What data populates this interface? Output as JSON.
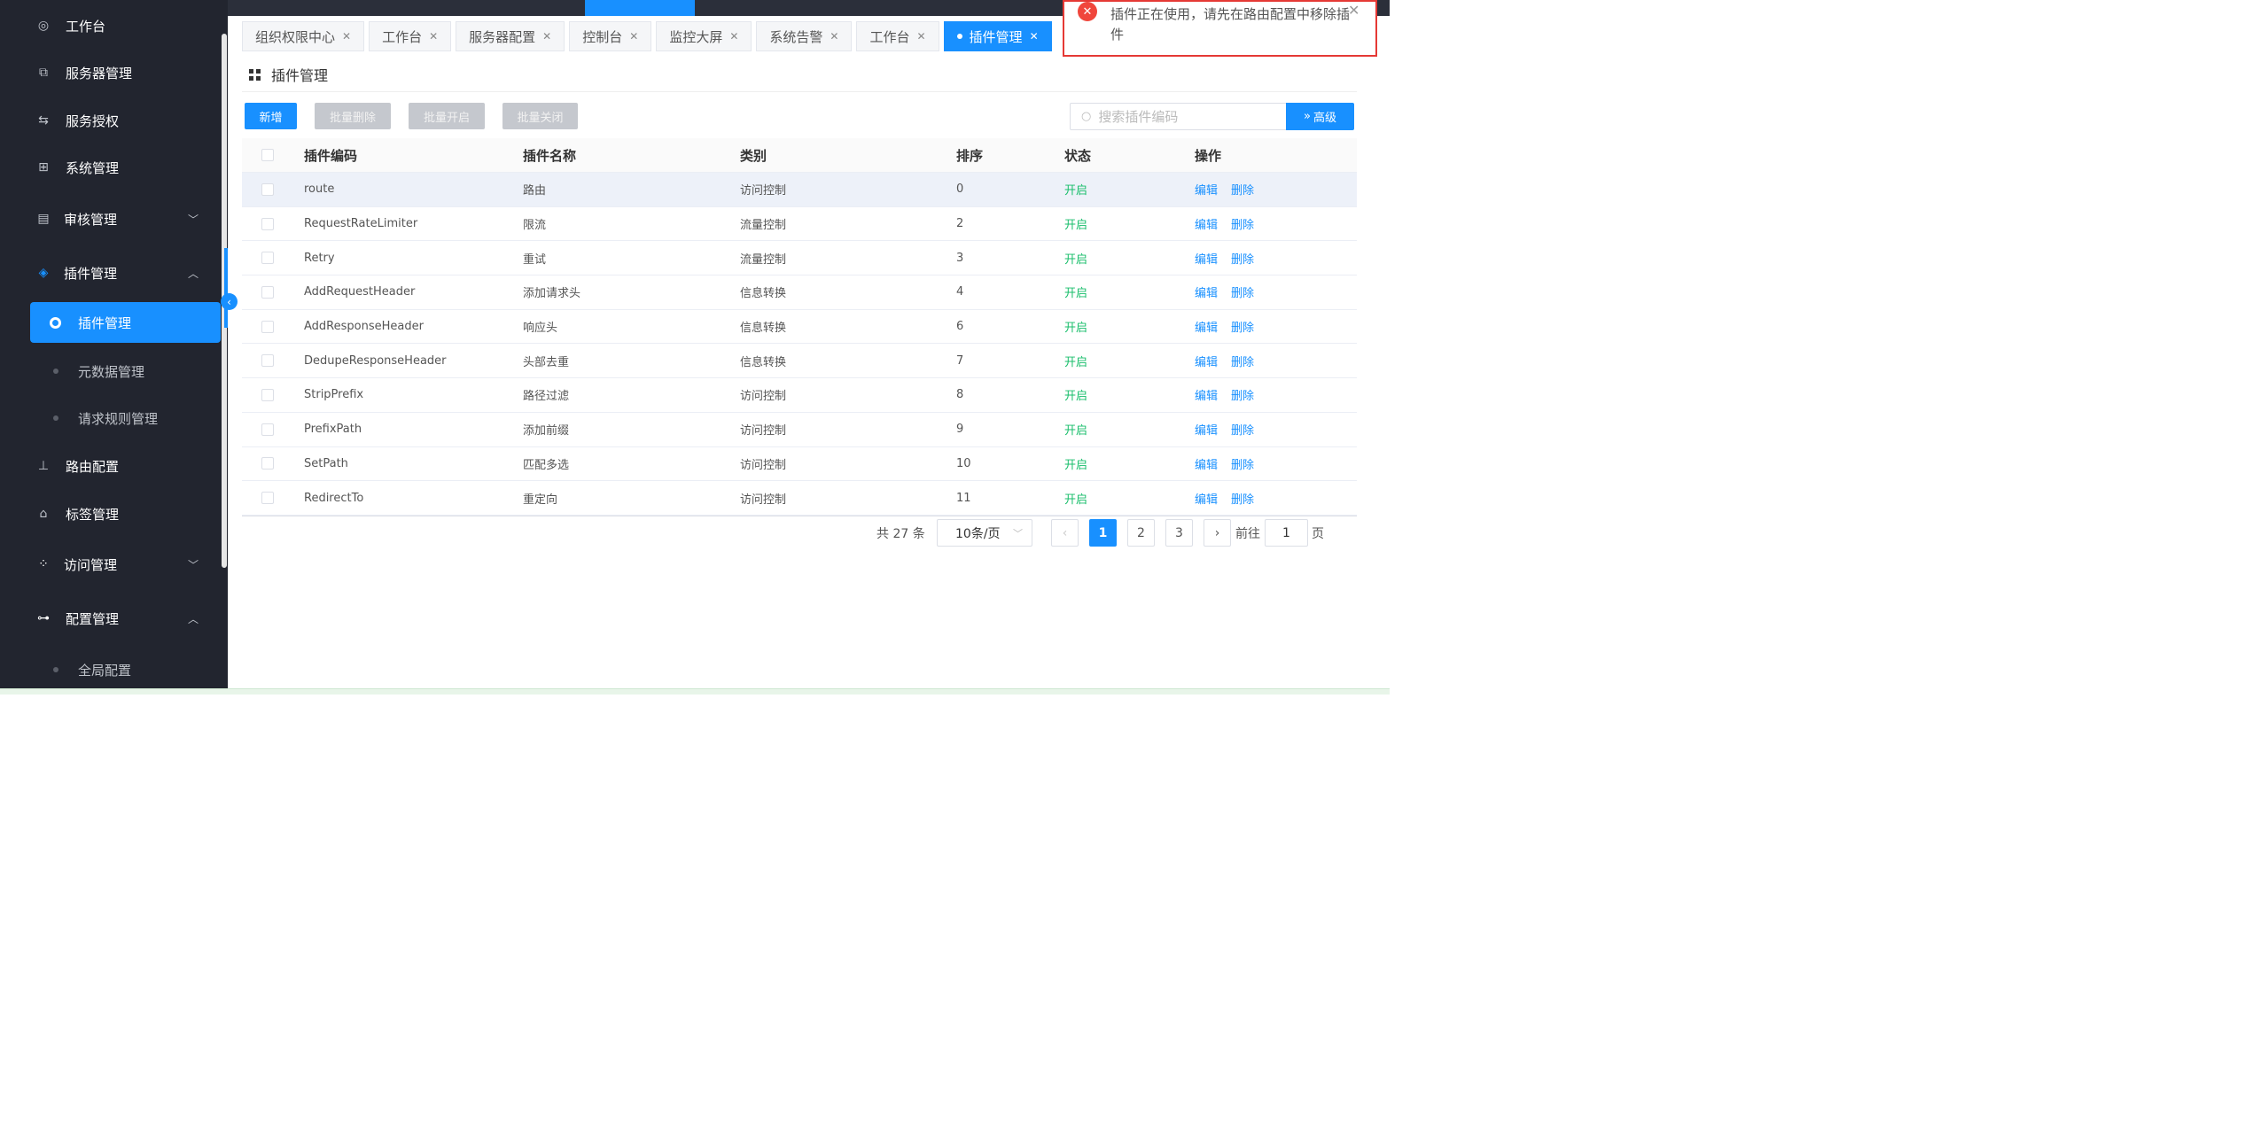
{
  "sidebar": {
    "items": [
      {
        "label": "工作台",
        "icon": "fingerprint-icon"
      },
      {
        "label": "服务器管理",
        "icon": "copy-icon"
      },
      {
        "label": "服务授权",
        "icon": "swap-icon"
      },
      {
        "label": "系统管理",
        "icon": "grid-icon"
      },
      {
        "label": "审核管理",
        "icon": "audit-icon"
      },
      {
        "label": "插件管理",
        "icon": "diamond-icon"
      },
      {
        "label": "路由配置",
        "icon": "network-icon"
      },
      {
        "label": "标签管理",
        "icon": "tag-icon"
      },
      {
        "label": "访问管理",
        "icon": "apps-icon"
      },
      {
        "label": "配置管理",
        "icon": "sitemap-icon"
      }
    ],
    "plugin_sub": [
      "插件管理",
      "元数据管理",
      "请求规则管理"
    ],
    "config_sub": [
      "全局配置"
    ]
  },
  "tabs": [
    {
      "label": "组织权限中心"
    },
    {
      "label": "工作台"
    },
    {
      "label": "服务器配置"
    },
    {
      "label": "控制台"
    },
    {
      "label": "监控大屏"
    },
    {
      "label": "系统告警"
    },
    {
      "label": "工作台"
    },
    {
      "label": "插件管理",
      "active": true
    }
  ],
  "page": {
    "title": "插件管理"
  },
  "toolbar": {
    "add": "新增",
    "batch_delete": "批量删除",
    "batch_enable": "批量开启",
    "batch_disable": "批量关闭",
    "search_placeholder": "搜索插件编码",
    "advanced": "高级"
  },
  "table": {
    "headers": [
      "插件编码",
      "插件名称",
      "类别",
      "排序",
      "状态",
      "操作"
    ],
    "rows": [
      {
        "code": "route",
        "name": "路由",
        "category": "访问控制",
        "sort": "0",
        "status": "开启"
      },
      {
        "code": "RequestRateLimiter",
        "name": "限流",
        "category": "流量控制",
        "sort": "2",
        "status": "开启"
      },
      {
        "code": "Retry",
        "name": "重试",
        "category": "流量控制",
        "sort": "3",
        "status": "开启"
      },
      {
        "code": "AddRequestHeader",
        "name": "添加请求头",
        "category": "信息转换",
        "sort": "4",
        "status": "开启"
      },
      {
        "code": "AddResponseHeader",
        "name": "响应头",
        "category": "信息转换",
        "sort": "6",
        "status": "开启"
      },
      {
        "code": "DedupeResponseHeader",
        "name": "头部去重",
        "category": "信息转换",
        "sort": "7",
        "status": "开启"
      },
      {
        "code": "StripPrefix",
        "name": "路径过滤",
        "category": "访问控制",
        "sort": "8",
        "status": "开启"
      },
      {
        "code": "PrefixPath",
        "name": "添加前缀",
        "category": "访问控制",
        "sort": "9",
        "status": "开启"
      },
      {
        "code": "SetPath",
        "name": "匹配多选",
        "category": "访问控制",
        "sort": "10",
        "status": "开启"
      },
      {
        "code": "RedirectTo",
        "name": "重定向",
        "category": "访问控制",
        "sort": "11",
        "status": "开启"
      }
    ],
    "edit_label": "编辑",
    "delete_label": "删除"
  },
  "pagination": {
    "total": "共 27 条",
    "page_size": "10条/页",
    "pages": [
      "1",
      "2",
      "3"
    ],
    "current": "1",
    "goto_prefix": "前往",
    "goto_value": "1",
    "goto_suffix": "页"
  },
  "notification": {
    "message": "插件正在使用，请先在路由配置中移除插件"
  },
  "colors": {
    "primary": "#1890ff",
    "sidebar_bg": "#22252f",
    "success": "#19be6b",
    "error": "#f0463c"
  }
}
